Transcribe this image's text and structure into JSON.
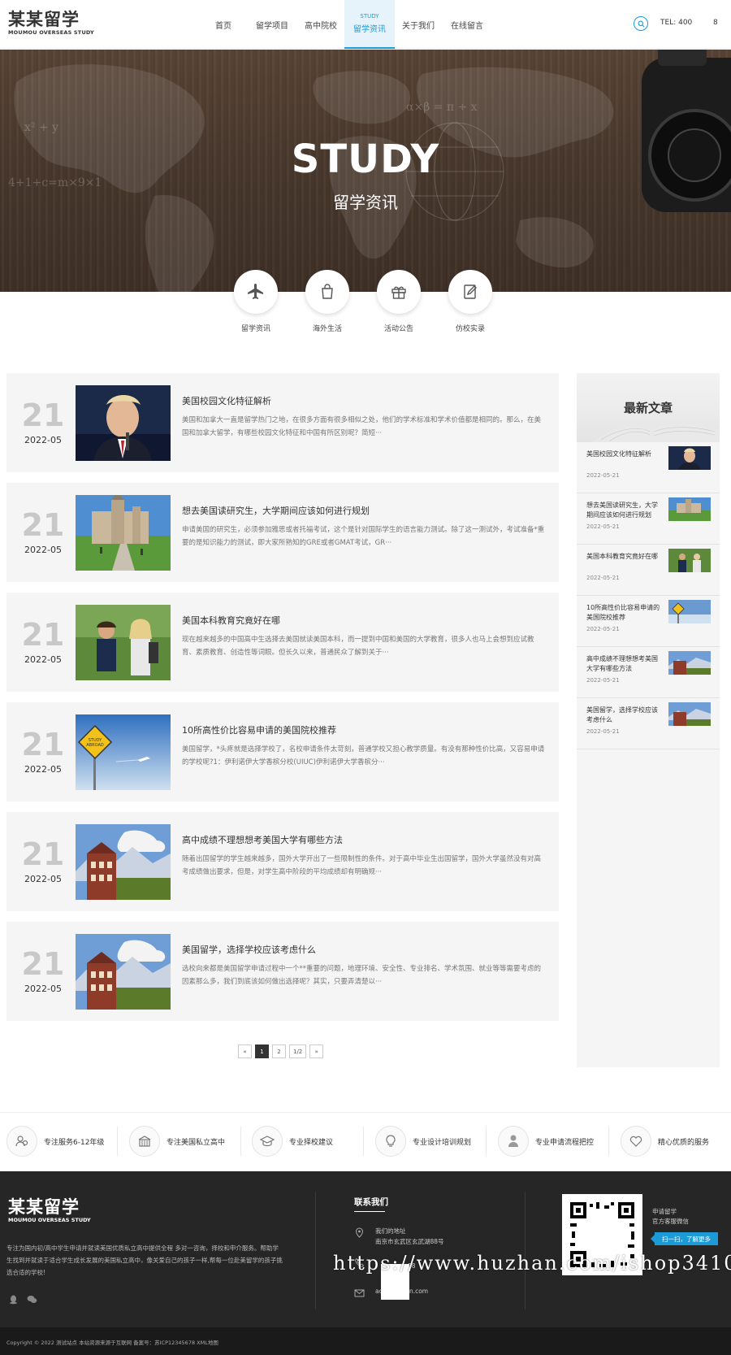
{
  "brand": {
    "logo_main": "某某留学",
    "logo_sub": "MOUMOU OVERSEAS STUDY"
  },
  "nav": {
    "items": [
      {
        "label": "首页"
      },
      {
        "label": "留学项目"
      },
      {
        "label": "高中院校"
      },
      {
        "label": "留学资讯",
        "en": "STUDY",
        "active": true
      },
      {
        "label": "关于我们"
      },
      {
        "label": "在线留言"
      }
    ],
    "tel": "TEL: 400",
    "tel_tail": "8"
  },
  "banner": {
    "title": "STUDY",
    "subtitle": "留学资讯"
  },
  "categories": [
    {
      "label": "留学资讯",
      "icon": "airplane-icon"
    },
    {
      "label": "海外生活",
      "icon": "shopping-bag-icon"
    },
    {
      "label": "活动公告",
      "icon": "gift-icon"
    },
    {
      "label": "仿校实录",
      "icon": "edit-icon"
    }
  ],
  "articles": [
    {
      "day": "21",
      "ym": "2022-05",
      "title": "美国校园文化特征解析",
      "desc": "美国和加拿大一直是留学热门之地，在很多方面有很多相似之处，他们的学术标准和学术价值都是相同的。那么，在美国和加拿大留学，有哪些校园文化特征和中国有所区别呢？简短···",
      "image": "speaker-photo"
    },
    {
      "day": "21",
      "ym": "2022-05",
      "title": "想去美国读研究生，大学期间应该如何进行规划",
      "desc": "申请美国的研究生，必须参加雅思或者托福考试，这个是针对国际学生的语言能力测试。除了这一测试外，考试准备*重要的是知识能力的测试，即大家所熟知的GRE或者GMAT考试，GR···",
      "image": "campus-photo"
    },
    {
      "day": "21",
      "ym": "2022-05",
      "title": "美国本科教育究竟好在哪",
      "desc": "现在越来越多的中国高中生选择去美国就读美国本科，而一提到中国和美国的大学教育，很多人也马上会想到应试教育、素质教育、创造性等词眼。但长久以来，普通民众了解到关于···",
      "image": "students-photo"
    },
    {
      "day": "21",
      "ym": "2022-05",
      "title": "10所高性价比容易申请的美国院校推荐",
      "desc": "美国留学，*头疼就是选择学校了，名校申请条件太苛刻，普通学校又担心教学质量。有没有那种性价比高，又容易申请的学校呢?1：伊利诺伊大学香槟分校(UIUC)伊利诺伊大学香槟分···",
      "image": "study-abroad-sign-photo"
    },
    {
      "day": "21",
      "ym": "2022-05",
      "title": "高中成绩不理想想考美国大学有哪些方法",
      "desc": "随着出国留学的学生越来越多，国外大学开出了一些限制性的条件。对于高中毕业生出国留学，国外大学虽然没有对高考成绩做出要求，但是，对学生高中阶段的平均成绩却有明确规···",
      "image": "university-building-photo"
    },
    {
      "day": "21",
      "ym": "2022-05",
      "title": "美国留学，选择学校应该考虑什么",
      "desc": "选校向来都是美国留学申请过程中一个**重要的问题，地理环境、安全性、专业排名、学术氛围、就业等等需要考虑的因素那么多，我们到底该如何做出选择呢？其实，只要弄清楚以···",
      "image": "university-building-photo"
    }
  ],
  "pagination": [
    "«",
    "1",
    "2",
    "1/2",
    "»"
  ],
  "sidebar": {
    "title": "最新文章",
    "items": [
      {
        "title": "美国校园文化特征解析",
        "date": "2022-05-21",
        "image": "speaker-photo"
      },
      {
        "title": "想去美国读研究生，大学期间应该如何进行规划",
        "date": "2022-05-21",
        "image": "campus-photo"
      },
      {
        "title": "美国本科教育究竟好在哪",
        "date": "2022-05-21",
        "image": "students-photo"
      },
      {
        "title": "10所高性价比容易申请的美国院校推荐",
        "date": "2022-05-21",
        "image": "study-abroad-sign-photo"
      },
      {
        "title": "高中成绩不理想想考美国大学有哪些方法",
        "date": "2022-05-21",
        "image": "university-building-photo"
      },
      {
        "title": "美国留学，选择学校应该考虑什么",
        "date": "2022-05-21",
        "image": "university-building-photo"
      }
    ]
  },
  "features": [
    {
      "label": "专注服务6-12年级",
      "icon": "users-icon"
    },
    {
      "label": "专注美国私立高中",
      "icon": "school-icon"
    },
    {
      "label": "专业择校建议",
      "icon": "graduation-cap-icon"
    },
    {
      "label": "专业设计培训规划",
      "icon": "lightbulb-icon"
    },
    {
      "label": "专业申请流程把控",
      "icon": "person-icon"
    },
    {
      "label": "精心优质的服务",
      "icon": "heart-icon"
    }
  ],
  "footer": {
    "logo_main": "某某留学",
    "logo_sub": "MOUMOU OVERSEAS STUDY",
    "desc": "专注为国内初/高中学生申请并就读美国优质私立高中提供全程 多对一咨询，择校和申介服务。帮助学生找到并就读于适合学生成长发展的美国私立高中，像关爱自己的孩子一样,帮每一位赴美留学的孩子挑选合适的学校!",
    "contact_title": "联系我们",
    "address_label": "我们的地址",
    "address": "南京市玄武区玄武湖88号",
    "phone_tail": "88",
    "email": "ac          min.com",
    "qr_caption": "申请留学\n官方客服微信",
    "qr_button": "扫一扫，了解更多",
    "copyright": "Copyright © 2022 测试站点 本站资源来源于互联网 备案号：苏ICP12345678 XML地图"
  },
  "watermark": "https://www.huzhan.com/ishop34101",
  "colors": {
    "accent": "#1d9bd7",
    "footer_bg": "#262626",
    "card_bg": "#f5f5f5"
  }
}
